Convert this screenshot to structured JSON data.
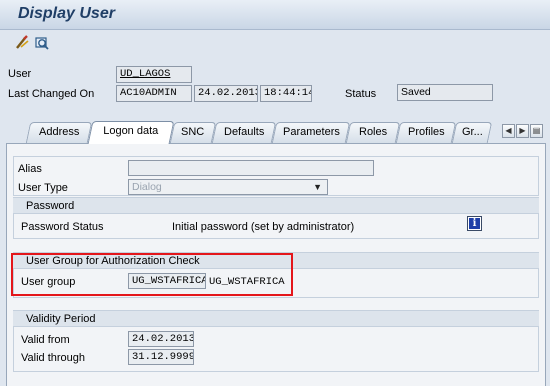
{
  "window": {
    "title": "Display User"
  },
  "toolbar": {
    "icons": [
      "edit-icon",
      "display-other-icon"
    ]
  },
  "header": {
    "user_label": "User",
    "user_value": "UD_LAGOS",
    "last_changed_label": "Last Changed On",
    "changed_by": "AC10ADMIN",
    "changed_date": "24.02.2013",
    "changed_time": "18:44:14",
    "status_label": "Status",
    "status_value": "Saved"
  },
  "tabs": [
    {
      "label": "Address",
      "active": false
    },
    {
      "label": "Logon data",
      "active": true
    },
    {
      "label": "SNC",
      "active": false
    },
    {
      "label": "Defaults",
      "active": false
    },
    {
      "label": "Parameters",
      "active": false
    },
    {
      "label": "Roles",
      "active": false
    },
    {
      "label": "Profiles",
      "active": false
    },
    {
      "label": "Gr...",
      "active": false
    }
  ],
  "logon": {
    "alias_label": "Alias",
    "alias_value": "",
    "user_type_label": "User Type",
    "user_type_value": "Dialog",
    "password_group": "Password",
    "password_status_label": "Password Status",
    "password_status_value": "Initial password (set by administrator)",
    "auth_group_title": "User Group for Authorization Check",
    "user_group_label": "User group",
    "user_group_value": "UG_WSTAFRICA",
    "user_group_desc": "UG_WSTAFRICA",
    "validity_title": "Validity Period",
    "valid_from_label": "Valid from",
    "valid_from_value": "24.02.2013",
    "valid_through_label": "Valid through",
    "valid_through_value": "31.12.9999"
  },
  "colors": {
    "highlight": "#e4161b",
    "info_icon": "#1e3fa8"
  }
}
